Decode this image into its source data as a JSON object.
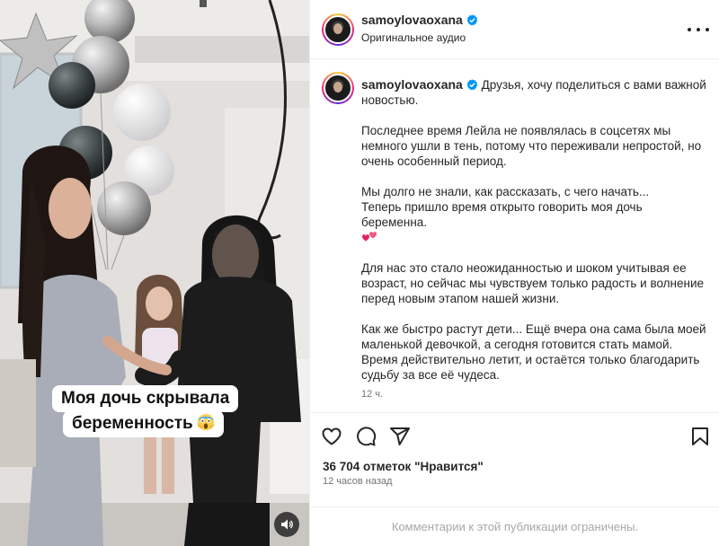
{
  "post": {
    "username": "samoylovaoxana",
    "audio_label": "Оригинальное аудио",
    "more_icon": "more-horizontal-icon",
    "verified_icon": "verified-badge-icon"
  },
  "media": {
    "caption_line1": "Моя дочь скрывала",
    "caption_line2": "беременность",
    "caption_emoji": "scream-emoji",
    "sound_icon": "speaker-icon"
  },
  "caption": {
    "username": "samoylovaoxana",
    "intro": "Друзья, хочу поделиться с вами важной новостью.",
    "paragraph2": "Последнее время Лейла не появлялась в соцсетях мы немного ушли в тень, потому что переживали непростой, но очень особенный период.",
    "paragraph3_line1": "Мы долго не знали, как рассказать, с чего начать...",
    "paragraph3_line2": "Теперь пришло время открыто говорить моя дочь беременна.",
    "paragraph4": "Для нас это стало неожиданностью и шоком учитывая ее возраст, но сейчас мы чувствуем только радость и волнение перед новым этапом нашей жизни.",
    "paragraph5": "Как же быстро растут дети... Ещё вчера она сама была моей маленькой девочкой, а сегодня готовится стать мамой. Время действительно летит, и остаётся только благодарить судьбу за все её чудеса.",
    "time": "12 ч.",
    "heart_emoji": "red-hearts-emoji"
  },
  "actions": {
    "like_icon": "heart-icon",
    "comment_icon": "comment-icon",
    "share_icon": "share-icon",
    "save_icon": "bookmark-icon"
  },
  "likes_text": "36 704 отметок \"Нравится\"",
  "posted_time": "12 часов назад",
  "comments_restricted": "Комментарии к этой публикации ограничены.",
  "colors": {
    "text": "#262626",
    "secondary": "#737373",
    "muted": "#a8a8a8",
    "verified": "#0095f6",
    "divider": "#efefef"
  }
}
